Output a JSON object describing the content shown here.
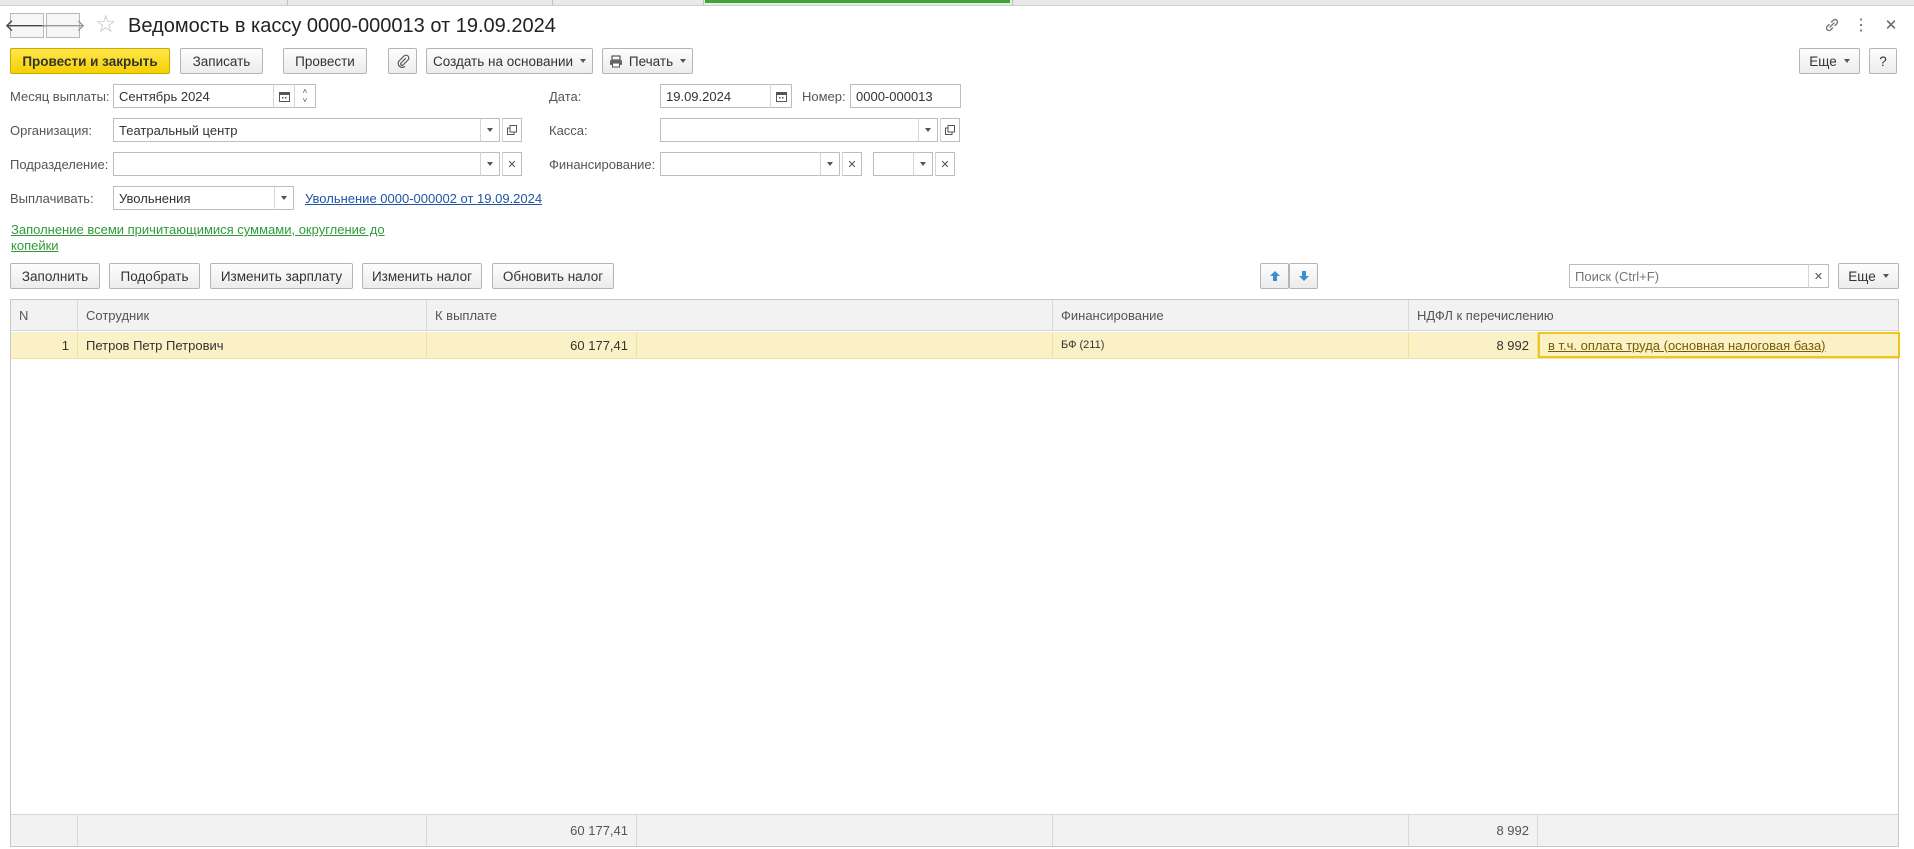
{
  "window": {
    "title": "Ведомость в кассу 0000-000013 от 19.09.2024"
  },
  "toolbar": {
    "post_close": "Провести и закрыть",
    "save": "Записать",
    "post": "Провести",
    "create_based": "Создать на основании",
    "print": "Печать",
    "more": "Еще",
    "help": "?"
  },
  "form": {
    "month_label": "Месяц выплаты:",
    "month_value": "Сентябрь 2024",
    "date_label": "Дата:",
    "date_value": "19.09.2024",
    "number_label": "Номер:",
    "number_value": "0000-000013",
    "org_label": "Организация:",
    "org_value": "Театральный центр",
    "cash_label": "Касса:",
    "cash_value": "",
    "dept_label": "Подразделение:",
    "dept_value": "",
    "fin_label": "Финансирование:",
    "fin_value": "",
    "fin_value2": "",
    "pay_label": "Выплачивать:",
    "pay_value": "Увольнения",
    "pay_link": "Увольнение 0000-000002 от 19.09.2024",
    "fill_link": "Заполнение всеми причитающимися суммами, округление до копейки"
  },
  "table_toolbar": {
    "fill": "Заполнить",
    "pick": "Подобрать",
    "change_salary": "Изменить зарплату",
    "change_tax": "Изменить налог",
    "update_tax": "Обновить налог",
    "search_placeholder": "Поиск (Ctrl+F)",
    "more": "Еще"
  },
  "table": {
    "columns": [
      "N",
      "Сотрудник",
      "К выплате",
      "",
      "Финансирование",
      "НДФЛ к перечислению",
      ""
    ],
    "rows": [
      {
        "n": "1",
        "employee": "Петров Петр Петрович",
        "amount": "60 177,41",
        "financing": "БФ (211)",
        "ndfl": "8 992",
        "ndfl_link": "в т.ч. оплата труда (основная налоговая база)"
      }
    ],
    "totals": {
      "amount": "60 177,41",
      "ndfl": "8 992"
    }
  },
  "colors": {
    "primary_button": "#f5d000",
    "selected_row": "#fbf1c7",
    "link_blue": "#1f55a5",
    "link_green": "#2f9a3a",
    "active_tab": "#3fa535"
  }
}
